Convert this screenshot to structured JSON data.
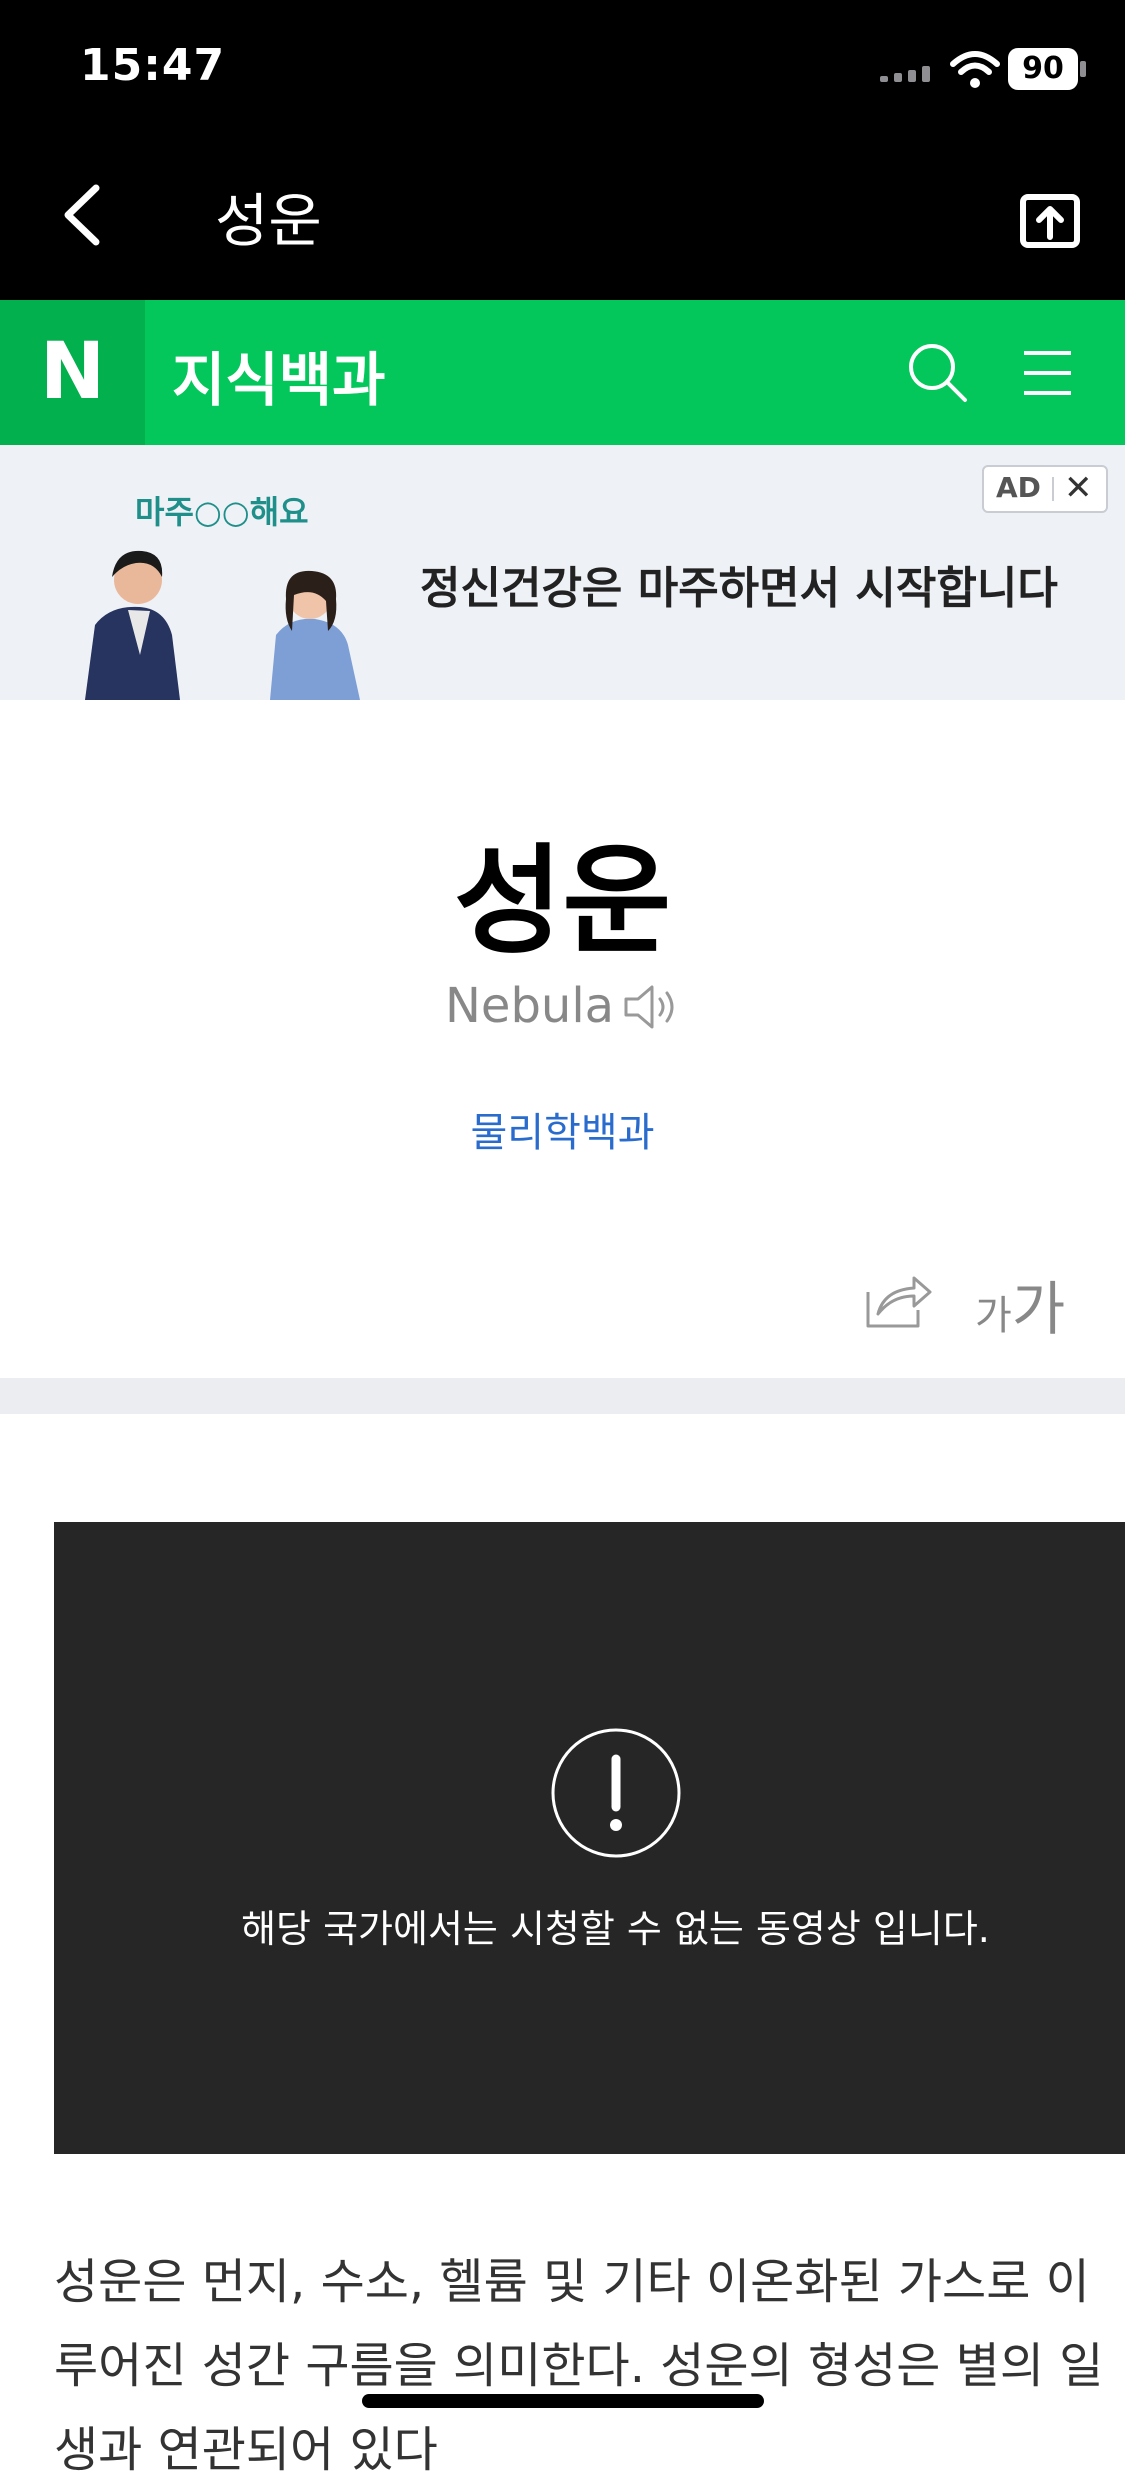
{
  "status_bar": {
    "time": "15:47",
    "battery": "90"
  },
  "browser_header": {
    "title": "성운"
  },
  "naver_bar": {
    "logo": "N",
    "site_name": "지식백과"
  },
  "ad": {
    "badge": "AD",
    "close": "✕",
    "logo_text": "마주○○해요",
    "headline": "정신건강은 마주하면서 시작합니다"
  },
  "entry": {
    "title": "성운",
    "subtitle": "Nebula",
    "category": "물리학백과",
    "font_small": "가",
    "font_big": "가"
  },
  "video": {
    "message": "해당 국가에서는 시청할 수 없는 동영상 입니다."
  },
  "body": {
    "lines": [
      "성운은 먼지, 수소, 헬륨 및 기타 이온화된 가스로 이",
      "루어진 성간 구름을 의미한다. 성운의 형성은 별의 일",
      "생과 연관되어 있다"
    ]
  },
  "icons": {
    "back": "chevron-left-icon",
    "share_top": "share-box-icon",
    "search": "search-icon",
    "menu": "menu-icon",
    "speaker": "speaker-icon",
    "share": "share-arrow-icon",
    "alert": "alert-icon"
  },
  "colors": {
    "naver_green": "#03c75a",
    "link_blue": "#2a6ccd",
    "video_bg": "#262626"
  }
}
